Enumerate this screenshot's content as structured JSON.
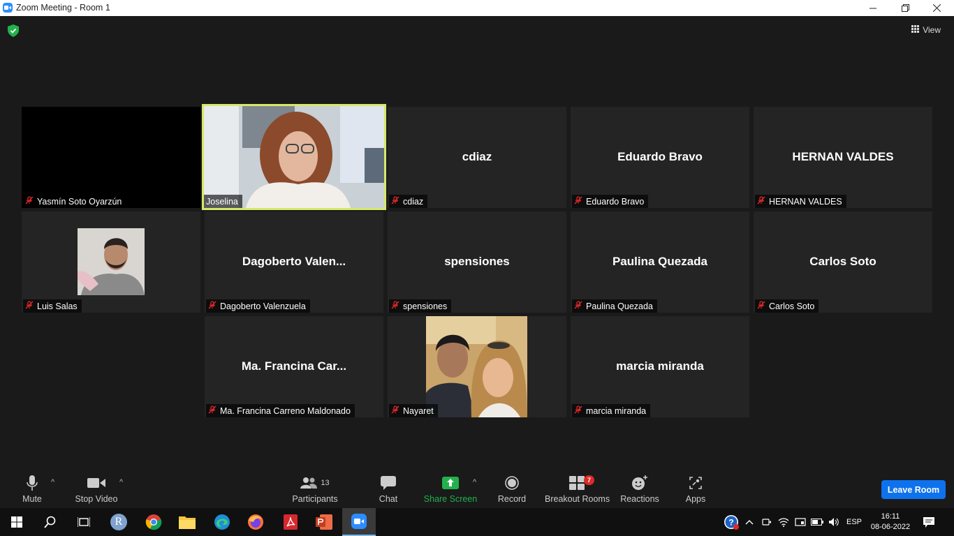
{
  "window": {
    "title": "Zoom Meeting - Room 1"
  },
  "topbar": {
    "view_label": "View"
  },
  "tiles": [
    {
      "name": "Yasmín Soto Oyarzún",
      "display": ""
    },
    {
      "name": "Joselina",
      "display": ""
    },
    {
      "name": "cdiaz",
      "display": "cdiaz"
    },
    {
      "name": "Eduardo Bravo",
      "display": "Eduardo Bravo"
    },
    {
      "name": "HERNAN VALDES",
      "display": "HERNAN VALDES"
    },
    {
      "name": "Luis Salas",
      "display": ""
    },
    {
      "name": "Dagoberto Valenzuela",
      "display": "Dagoberto  Valen..."
    },
    {
      "name": "spensiones",
      "display": "spensiones"
    },
    {
      "name": "Paulina Quezada",
      "display": "Paulina Quezada"
    },
    {
      "name": "Carlos Soto",
      "display": "Carlos Soto"
    },
    {
      "name": "Ma. Francina Carreno Maldonado",
      "display": "Ma. Francina Car..."
    },
    {
      "name": "Nayaret",
      "display": ""
    },
    {
      "name": "marcia miranda",
      "display": "marcia miranda"
    }
  ],
  "toolbar": {
    "mute": "Mute",
    "stop_video": "Stop Video",
    "participants": "Participants",
    "participants_count": "13",
    "chat": "Chat",
    "share_screen": "Share Screen",
    "record": "Record",
    "breakout_rooms": "Breakout Rooms",
    "breakout_badge": "7",
    "reactions": "Reactions",
    "apps": "Apps",
    "leave": "Leave Room"
  },
  "taskbar": {
    "language": "ESP",
    "time": "16:11",
    "date": "08-06-2022",
    "r_app_letter": "R"
  },
  "colors": {
    "accent_blue": "#0e72ed",
    "share_green": "#22b14c",
    "active_speaker_border": "#d6e86b",
    "muted_red": "#e02828"
  }
}
